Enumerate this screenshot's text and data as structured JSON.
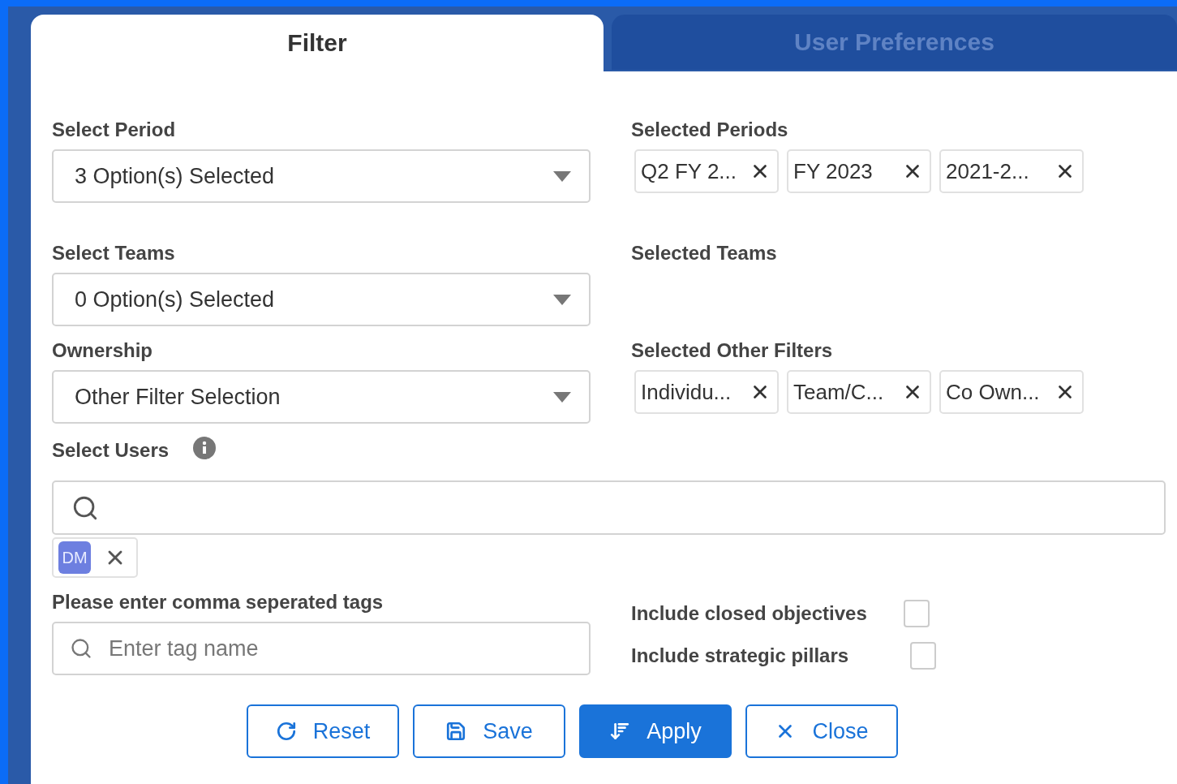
{
  "tabs": [
    {
      "label": "Filter",
      "selected": true
    },
    {
      "label": "User Preferences",
      "selected": false
    }
  ],
  "rows": [
    {
      "left": {
        "label": "Select Period",
        "value": "3 Option(s) Selected"
      },
      "right": {
        "label": "Selected Periods",
        "chips": [
          "Q2 FY 2...",
          "FY 2023",
          "2021-2..."
        ]
      }
    },
    {
      "left": {
        "label": "Select Teams",
        "value": "0 Option(s) Selected"
      },
      "right": {
        "label": "Selected Teams"
      }
    },
    {
      "left": {
        "label": "Ownership",
        "value": "Other Filter Selection"
      },
      "right": {
        "label": "Selected Other Filters",
        "chips": [
          "Individu...",
          "Team/C...",
          "Co Own..."
        ]
      }
    }
  ],
  "users": {
    "label": "Select Users",
    "selected_users": [
      {
        "initials": "DM"
      }
    ]
  },
  "tags": {
    "label": "Please enter comma seperated tags",
    "placeholder": "Enter tag name"
  },
  "options": [
    {
      "label": "Include closed objectives",
      "checked": false
    },
    {
      "label": "Include strategic pillars",
      "checked": false
    }
  ],
  "buttons": [
    {
      "kind": "reset",
      "label": "Reset",
      "filled": false
    },
    {
      "kind": "save",
      "label": "Save",
      "filled": false
    },
    {
      "kind": "apply",
      "label": "Apply",
      "filled": true
    },
    {
      "kind": "close",
      "label": "Close",
      "filled": false
    }
  ]
}
